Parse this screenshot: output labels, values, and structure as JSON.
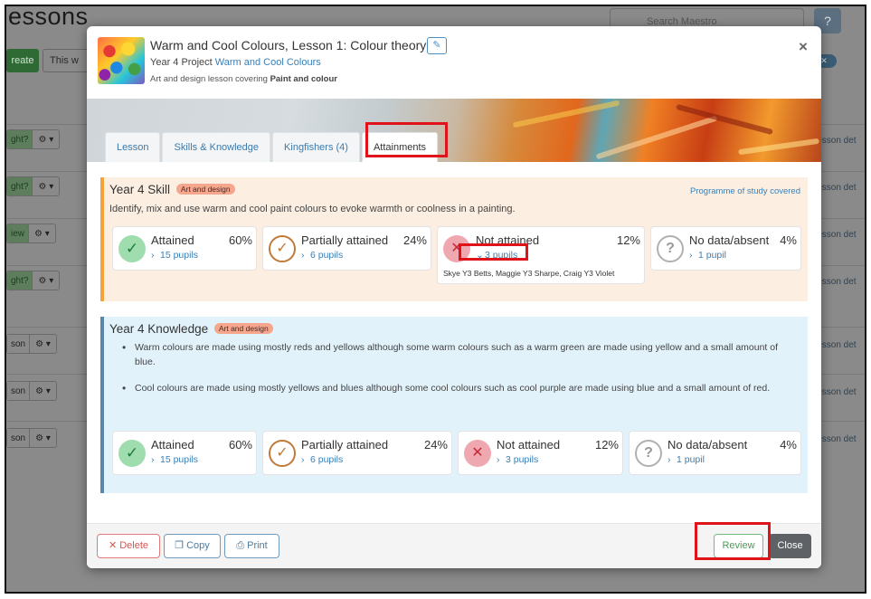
{
  "background": {
    "page_title": "essons",
    "search_placeholder": "Search Maestro",
    "help_label": "?",
    "create_label": "reate",
    "filter_label": "This w",
    "badge_label": "✕",
    "rows": [
      {
        "pill_left": "ght?",
        "pill_right": "⚙ ▾",
        "link": "lesson det"
      },
      {
        "pill_left": "ght?",
        "pill_right": "⚙ ▾",
        "link": "lesson det"
      },
      {
        "pill_left": "iew",
        "pill_right": "⚙ ▾",
        "link": "lesson det"
      },
      {
        "pill_left": "ght?",
        "pill_right": "⚙ ▾",
        "link": "lesson det"
      },
      {
        "pill_left": "son",
        "pill_right": "⚙ ▾",
        "link": "lesson det"
      },
      {
        "pill_left": "son",
        "pill_right": "⚙ ▾",
        "link": "lesson det"
      },
      {
        "pill_left": "son",
        "pill_right": "⚙ ▾",
        "link": "lesson det"
      }
    ]
  },
  "modal": {
    "title": "Warm and Cool Colours, Lesson 1: Colour theory",
    "edit_icon": "✎",
    "subtitle_prefix": "Year 4 Project",
    "subtitle_link": "Warm and Cool Colours",
    "desc_prefix": "Art and design lesson covering",
    "desc_bold": "Paint and colour",
    "close_icon": "×",
    "tabs": [
      {
        "label": "Lesson"
      },
      {
        "label": "Skills & Knowledge"
      },
      {
        "label": "Kingfishers (4)"
      },
      {
        "label": "Attainments"
      }
    ],
    "skill": {
      "title": "Year 4 Skill",
      "tag": "Art and design",
      "programme": "Programme of study covered",
      "text": "Identify, mix and use warm and cool paint colours to evoke warmth or coolness in a painting.",
      "cards": [
        {
          "label": "Attained",
          "pct": "60%",
          "pupils": "15 pupils",
          "icon": "✓"
        },
        {
          "label": "Partially attained",
          "pct": "24%",
          "pupils": "6 pupils",
          "icon": "✓"
        },
        {
          "label": "Not attained",
          "pct": "12%",
          "pupils": "3 pupils",
          "icon": "✕",
          "names": "Skye Y3 Betts, Maggie Y3 Sharpe, Craig Y3 Violet"
        },
        {
          "label": "No data/absent",
          "pct": "4%",
          "pupils": "1 pupil",
          "icon": "?"
        }
      ]
    },
    "knowledge": {
      "title": "Year 4 Knowledge",
      "tag": "Art and design",
      "bullets": [
        "Warm colours are made using mostly reds and yellows although some warm colours such as a warm green are made using yellow and a small amount of blue.",
        "Cool colours are made using mostly yellows and blues although some cool colours such as cool purple are made using blue and a small amount of red."
      ],
      "cards": [
        {
          "label": "Attained",
          "pct": "60%",
          "pupils": "15 pupils",
          "icon": "✓"
        },
        {
          "label": "Partially attained",
          "pct": "24%",
          "pupils": "6 pupils",
          "icon": "✓"
        },
        {
          "label": "Not attained",
          "pct": "12%",
          "pupils": "3 pupils",
          "icon": "✕"
        },
        {
          "label": "No data/absent",
          "pct": "4%",
          "pupils": "1 pupil",
          "icon": "?"
        }
      ]
    },
    "footer": {
      "delete": "✕ Delete",
      "copy": "❐ Copy",
      "print": "⎙ Print",
      "review": "Review",
      "close": "Close"
    }
  }
}
